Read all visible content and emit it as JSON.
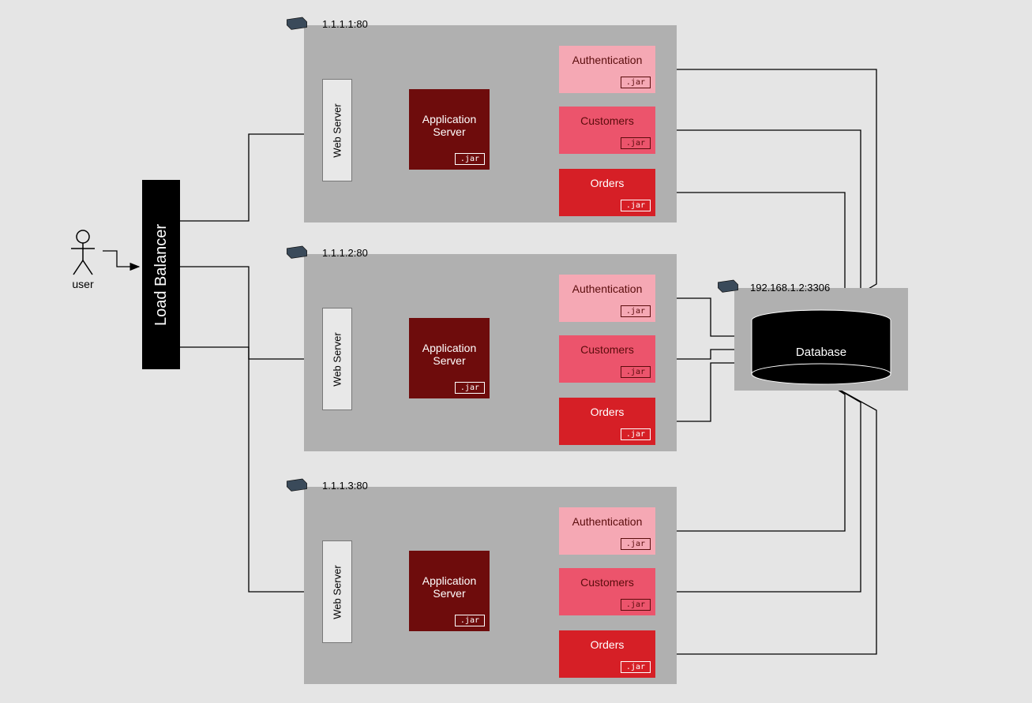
{
  "user_label": "user",
  "load_balancer": "Load Balancer",
  "web_server": "Web Server",
  "app_server": "Application Server",
  "jar": ".jar",
  "services": {
    "auth": "Authentication",
    "cust": "Customers",
    "ord": "Orders"
  },
  "groups": {
    "g1": "1.1.1.1:80",
    "g2": "1.1.1.2:80",
    "g3": "1.1.1.3:80",
    "db": "192.168.1.2:3306"
  },
  "database": "Database",
  "colors": {
    "bg": "#e5e5e5",
    "group": "#b0b0b0",
    "webserver": "#e8e8e8",
    "appserver": "#6e0c0c",
    "auth": "#f5a8b4",
    "cust": "#ec546c",
    "ord": "#d61f26",
    "black": "#000000"
  }
}
